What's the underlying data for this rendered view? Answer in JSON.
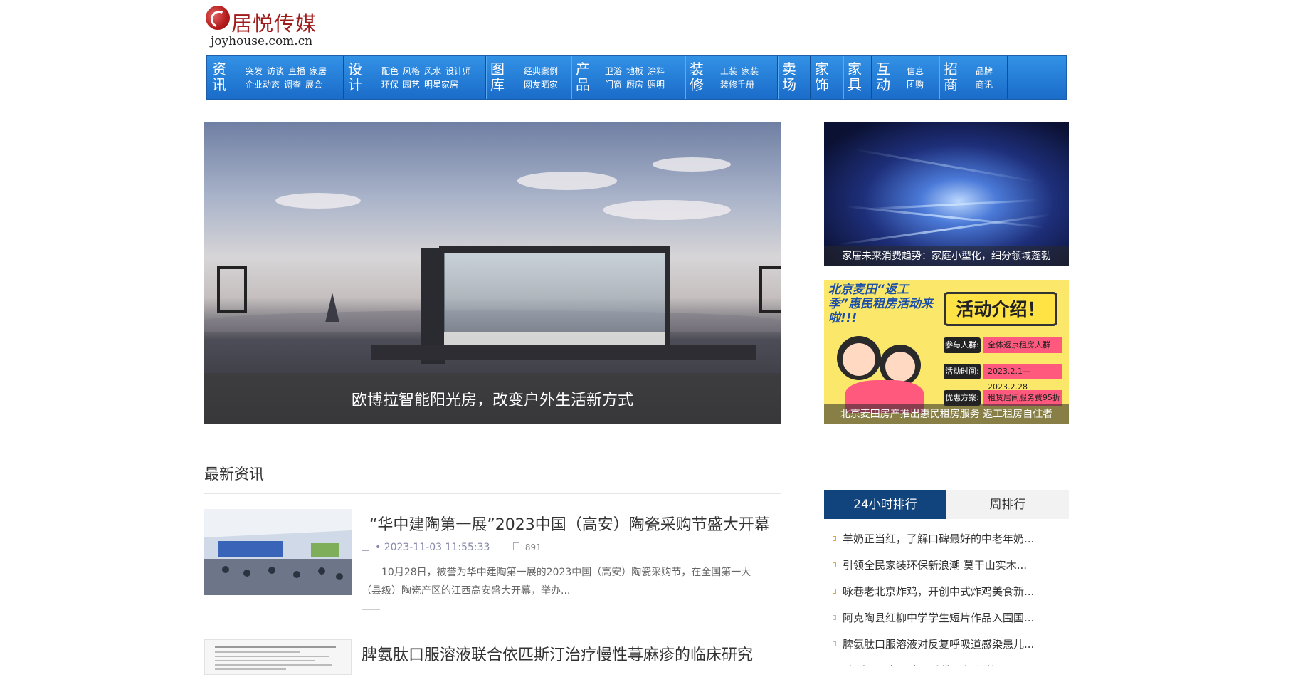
{
  "header": {
    "logo_cn": "居悦传媒",
    "logo_en": "joyhouse.com.cn"
  },
  "nav": [
    {
      "category": "资讯",
      "links": [
        [
          "突发",
          "访谈",
          "直播",
          "家居"
        ],
        [
          "企业动态",
          "调查",
          "展会"
        ]
      ]
    },
    {
      "category": "设计",
      "links": [
        [
          "配色",
          "风格",
          "风水",
          "设计师"
        ],
        [
          "环保",
          "园艺",
          "明星家居"
        ]
      ]
    },
    {
      "category": "图库",
      "links": [
        [
          "经典案例"
        ],
        [
          "网友晒家"
        ]
      ]
    },
    {
      "category": "产品",
      "links": [
        [
          "卫浴",
          "地板",
          "涂料"
        ],
        [
          "门窗",
          "厨房",
          "照明"
        ]
      ]
    },
    {
      "category": "装修",
      "links": [
        [
          "工装",
          "家装"
        ],
        [
          "装修手册"
        ]
      ]
    },
    {
      "category": "卖场",
      "links": []
    },
    {
      "category": "家饰",
      "links": []
    },
    {
      "category": "家具",
      "links": []
    },
    {
      "category": "互动",
      "links": [
        [
          "信息"
        ],
        [
          "团购"
        ]
      ]
    },
    {
      "category": "招商",
      "links": [
        [
          "品牌"
        ],
        [
          "商讯"
        ]
      ]
    }
  ],
  "hero": {
    "caption": "欧博拉智能阳光房，改变户外生活新方式",
    "prev_icon": "arrow-left-icon",
    "next_icon": "arrow-right-icon"
  },
  "side": {
    "item1_caption": "家居未来消费趋势：家庭小型化，细分领域蓬勃",
    "item2_caption": "北京麦田房产推出惠民租房服务 返工租房自住者",
    "item2_banner": {
      "headline": "北京麦田“返工季”惠民租房活动来啦!!!",
      "act_title": "活动介绍！",
      "rows": [
        {
          "k": "参与人群:",
          "v": "全体返京租房人群"
        },
        {
          "k": "活动时间:",
          "v": "2023.2.1—2023.2.28"
        },
        {
          "k": "优惠方案:",
          "v": "租赁居间服务费95折"
        }
      ]
    }
  },
  "latest": {
    "section_title": "最新资讯",
    "items": [
      {
        "title": "“华中建陶第一展”2023中国（高安）陶瓷采购节盛大开幕",
        "date": "• 2023-11-03 11:55:33",
        "views": "891",
        "summary": "10月28日，被誉为华中建陶第一展的2023中国（高安）陶瓷采购节，在全国第一大（县级）陶瓷产区的江西高安盛大开幕，举办..."
      },
      {
        "title": "脾氨肽口服溶液联合依匹斯汀治疗慢性荨麻疹的临床研究"
      }
    ]
  },
  "ranking": {
    "tab_active": "24小时排行",
    "tab_inactive": "周排行",
    "items": [
      "羊奶正当红，了解口碑最好的中老年奶...",
      "引领全民家装环保新浪潮 莫干山实木...",
      "咏巷老北京炸鸡，开创中式炸鸡美食新...",
      "阿克陶县红柳中学学生短片作品入围国...",
      "脾氨肽口服溶液对反复呼吸道感染患儿...",
      "“好产品+好服务” 成就阿鲁山彩石瓦..."
    ]
  },
  "colors": {
    "nav_blue": "#2a82d9",
    "rank_active": "#11447d",
    "logo_red": "#a01b1b"
  }
}
